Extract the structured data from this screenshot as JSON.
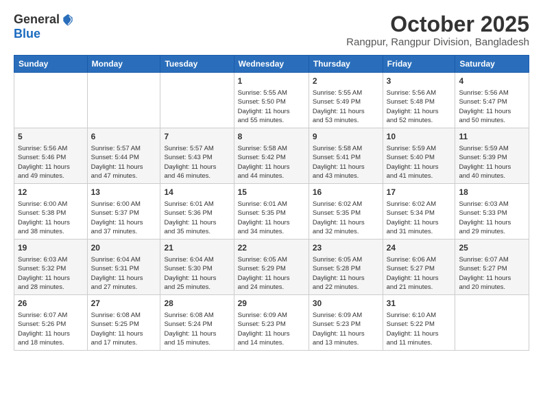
{
  "logo": {
    "general": "General",
    "blue": "Blue"
  },
  "header": {
    "month": "October 2025",
    "location": "Rangpur, Rangpur Division, Bangladesh"
  },
  "weekdays": [
    "Sunday",
    "Monday",
    "Tuesday",
    "Wednesday",
    "Thursday",
    "Friday",
    "Saturday"
  ],
  "weeks": [
    [
      {
        "day": "",
        "info": ""
      },
      {
        "day": "",
        "info": ""
      },
      {
        "day": "",
        "info": ""
      },
      {
        "day": "1",
        "info": "Sunrise: 5:55 AM\nSunset: 5:50 PM\nDaylight: 11 hours\nand 55 minutes."
      },
      {
        "day": "2",
        "info": "Sunrise: 5:55 AM\nSunset: 5:49 PM\nDaylight: 11 hours\nand 53 minutes."
      },
      {
        "day": "3",
        "info": "Sunrise: 5:56 AM\nSunset: 5:48 PM\nDaylight: 11 hours\nand 52 minutes."
      },
      {
        "day": "4",
        "info": "Sunrise: 5:56 AM\nSunset: 5:47 PM\nDaylight: 11 hours\nand 50 minutes."
      }
    ],
    [
      {
        "day": "5",
        "info": "Sunrise: 5:56 AM\nSunset: 5:46 PM\nDaylight: 11 hours\nand 49 minutes."
      },
      {
        "day": "6",
        "info": "Sunrise: 5:57 AM\nSunset: 5:44 PM\nDaylight: 11 hours\nand 47 minutes."
      },
      {
        "day": "7",
        "info": "Sunrise: 5:57 AM\nSunset: 5:43 PM\nDaylight: 11 hours\nand 46 minutes."
      },
      {
        "day": "8",
        "info": "Sunrise: 5:58 AM\nSunset: 5:42 PM\nDaylight: 11 hours\nand 44 minutes."
      },
      {
        "day": "9",
        "info": "Sunrise: 5:58 AM\nSunset: 5:41 PM\nDaylight: 11 hours\nand 43 minutes."
      },
      {
        "day": "10",
        "info": "Sunrise: 5:59 AM\nSunset: 5:40 PM\nDaylight: 11 hours\nand 41 minutes."
      },
      {
        "day": "11",
        "info": "Sunrise: 5:59 AM\nSunset: 5:39 PM\nDaylight: 11 hours\nand 40 minutes."
      }
    ],
    [
      {
        "day": "12",
        "info": "Sunrise: 6:00 AM\nSunset: 5:38 PM\nDaylight: 11 hours\nand 38 minutes."
      },
      {
        "day": "13",
        "info": "Sunrise: 6:00 AM\nSunset: 5:37 PM\nDaylight: 11 hours\nand 37 minutes."
      },
      {
        "day": "14",
        "info": "Sunrise: 6:01 AM\nSunset: 5:36 PM\nDaylight: 11 hours\nand 35 minutes."
      },
      {
        "day": "15",
        "info": "Sunrise: 6:01 AM\nSunset: 5:35 PM\nDaylight: 11 hours\nand 34 minutes."
      },
      {
        "day": "16",
        "info": "Sunrise: 6:02 AM\nSunset: 5:35 PM\nDaylight: 11 hours\nand 32 minutes."
      },
      {
        "day": "17",
        "info": "Sunrise: 6:02 AM\nSunset: 5:34 PM\nDaylight: 11 hours\nand 31 minutes."
      },
      {
        "day": "18",
        "info": "Sunrise: 6:03 AM\nSunset: 5:33 PM\nDaylight: 11 hours\nand 29 minutes."
      }
    ],
    [
      {
        "day": "19",
        "info": "Sunrise: 6:03 AM\nSunset: 5:32 PM\nDaylight: 11 hours\nand 28 minutes."
      },
      {
        "day": "20",
        "info": "Sunrise: 6:04 AM\nSunset: 5:31 PM\nDaylight: 11 hours\nand 27 minutes."
      },
      {
        "day": "21",
        "info": "Sunrise: 6:04 AM\nSunset: 5:30 PM\nDaylight: 11 hours\nand 25 minutes."
      },
      {
        "day": "22",
        "info": "Sunrise: 6:05 AM\nSunset: 5:29 PM\nDaylight: 11 hours\nand 24 minutes."
      },
      {
        "day": "23",
        "info": "Sunrise: 6:05 AM\nSunset: 5:28 PM\nDaylight: 11 hours\nand 22 minutes."
      },
      {
        "day": "24",
        "info": "Sunrise: 6:06 AM\nSunset: 5:27 PM\nDaylight: 11 hours\nand 21 minutes."
      },
      {
        "day": "25",
        "info": "Sunrise: 6:07 AM\nSunset: 5:27 PM\nDaylight: 11 hours\nand 20 minutes."
      }
    ],
    [
      {
        "day": "26",
        "info": "Sunrise: 6:07 AM\nSunset: 5:26 PM\nDaylight: 11 hours\nand 18 minutes."
      },
      {
        "day": "27",
        "info": "Sunrise: 6:08 AM\nSunset: 5:25 PM\nDaylight: 11 hours\nand 17 minutes."
      },
      {
        "day": "28",
        "info": "Sunrise: 6:08 AM\nSunset: 5:24 PM\nDaylight: 11 hours\nand 15 minutes."
      },
      {
        "day": "29",
        "info": "Sunrise: 6:09 AM\nSunset: 5:23 PM\nDaylight: 11 hours\nand 14 minutes."
      },
      {
        "day": "30",
        "info": "Sunrise: 6:09 AM\nSunset: 5:23 PM\nDaylight: 11 hours\nand 13 minutes."
      },
      {
        "day": "31",
        "info": "Sunrise: 6:10 AM\nSunset: 5:22 PM\nDaylight: 11 hours\nand 11 minutes."
      },
      {
        "day": "",
        "info": ""
      }
    ]
  ]
}
